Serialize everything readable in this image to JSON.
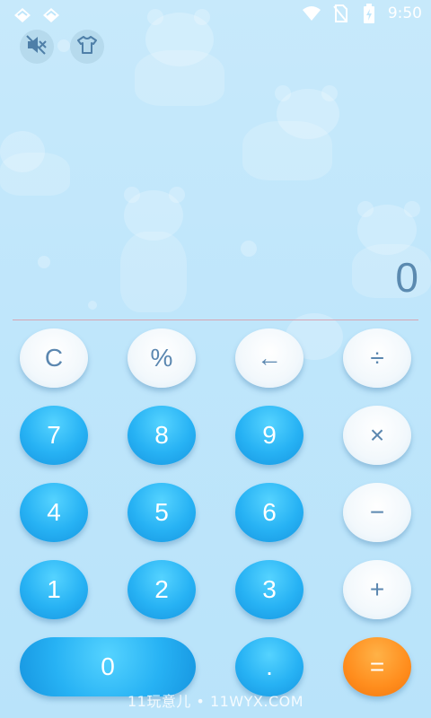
{
  "status_bar": {
    "time": "9:50",
    "icons": [
      "notification-icon",
      "notification-icon",
      "wifi-icon",
      "no-sim-icon",
      "battery-charging-icon"
    ]
  },
  "toolbar": {
    "sound_icon": "mute-icon",
    "skin_icon": "tshirt-icon"
  },
  "display": {
    "value": "0"
  },
  "keys": {
    "clear": "C",
    "percent": "%",
    "backspace": "←",
    "divide": "÷",
    "seven": "7",
    "eight": "8",
    "nine": "9",
    "multiply": "×",
    "four": "4",
    "five": "5",
    "six": "6",
    "minus": "−",
    "one": "1",
    "two": "2",
    "three": "3",
    "plus": "+",
    "zero": "0",
    "dot": ".",
    "equals": "="
  },
  "watermark": "11玩意儿 • 11WYX.COM",
  "colors": {
    "background": "#bfe6fb",
    "blue_key": "#27b2f4",
    "light_key": "#f2f8fc",
    "equals_key": "#ff8d1d",
    "display_text": "#5b8ab0"
  }
}
